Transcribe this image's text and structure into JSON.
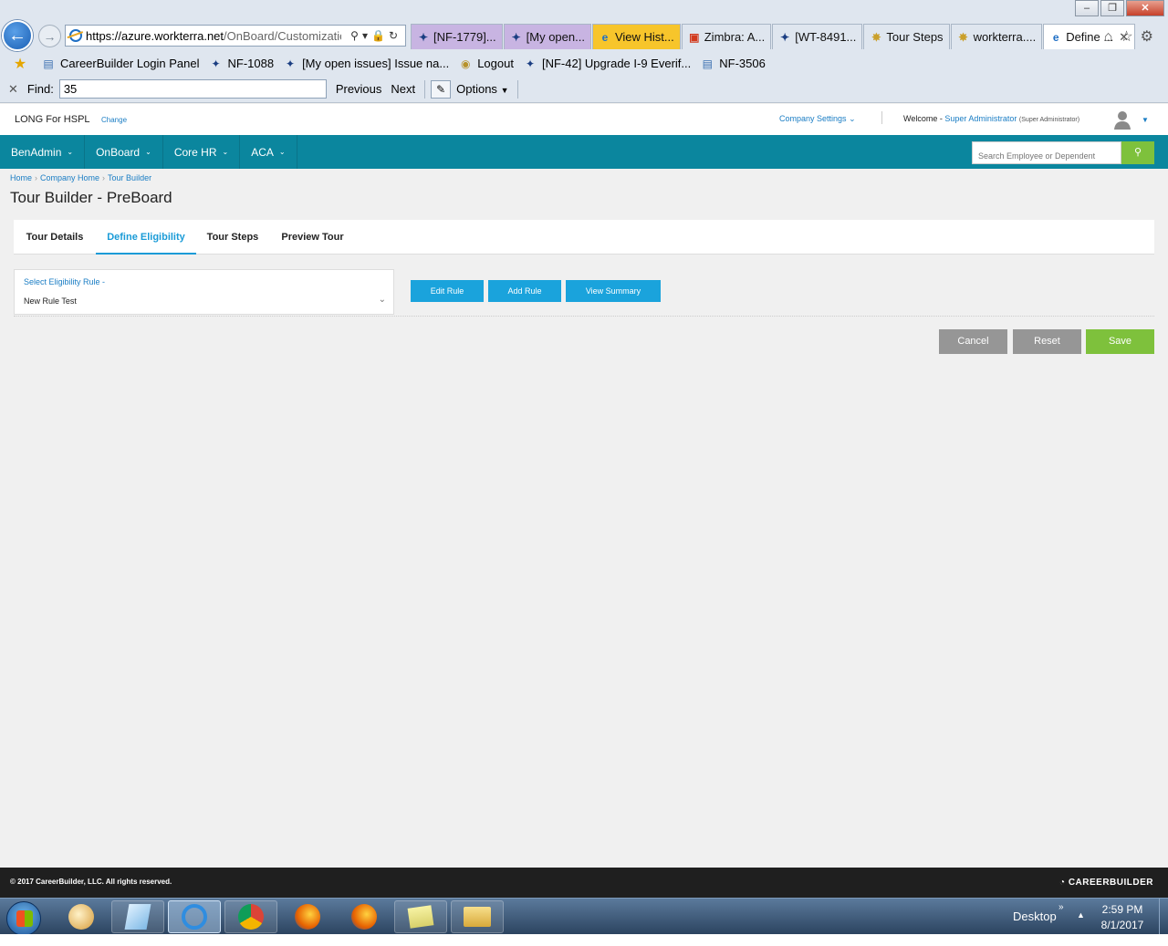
{
  "browser": {
    "url_host": "https://azure.workterra.net",
    "url_path": "/OnBoard/Customization/",
    "tabs": [
      {
        "label": "[NF-1779]...",
        "style": "purple",
        "icon": "jira-icon"
      },
      {
        "label": "[My open...",
        "style": "purple",
        "icon": "jira-icon"
      },
      {
        "label": "View Hist...",
        "style": "yellow",
        "icon": "ie-icon"
      },
      {
        "label": "Zimbra: A...",
        "style": "plain",
        "icon": "zimbra-icon"
      },
      {
        "label": "[WT-8491...",
        "style": "plain",
        "icon": "jira-icon"
      },
      {
        "label": "Tour Steps",
        "style": "plain",
        "icon": "workterra-icon"
      },
      {
        "label": "workterra....",
        "style": "plain",
        "icon": "workterra-icon"
      },
      {
        "label": "Define ...",
        "style": "active",
        "icon": "ie-icon"
      }
    ],
    "favorites": [
      {
        "label": "CareerBuilder Login Panel",
        "icon": "page-icon"
      },
      {
        "label": "NF-1088",
        "icon": "jira-icon"
      },
      {
        "label": "[My open issues] Issue na...",
        "icon": "jira-icon"
      },
      {
        "label": "Logout",
        "icon": "workterra-icon"
      },
      {
        "label": "[NF-42] Upgrade I-9 Everif...",
        "icon": "jira-icon"
      },
      {
        "label": "NF-3506",
        "icon": "page-icon"
      }
    ],
    "find": {
      "label": "Find:",
      "value": "35",
      "previous": "Previous",
      "next": "Next",
      "options": "Options"
    }
  },
  "header": {
    "company": "LONG For HSPL",
    "change": "Change",
    "company_settings": "Company Settings",
    "welcome_prefix": "Welcome -",
    "user_name": "Super Administrator",
    "user_role": "(Super Administrator)"
  },
  "nav": {
    "items": [
      "BenAdmin",
      "OnBoard",
      "Core HR",
      "ACA"
    ],
    "search_placeholder": "Search Employee or Dependent"
  },
  "breadcrumb": [
    "Home",
    "Company Home",
    "Tour Builder"
  ],
  "page": {
    "title": "Tour Builder - PreBoard",
    "tabs": [
      "Tour Details",
      "Define Eligibility",
      "Tour Steps",
      "Preview Tour"
    ],
    "active_tab": "Define Eligibility",
    "rule_label": "Select Eligibility Rule -",
    "rule_value": "New Rule Test",
    "buttons": {
      "edit": "Edit Rule",
      "add": "Add Rule",
      "summary": "View Summary"
    },
    "actions": {
      "cancel": "Cancel",
      "reset": "Reset",
      "save": "Save"
    }
  },
  "footer": {
    "copyright": "© 2017 CareerBuilder, LLC. All rights reserved.",
    "brand": "CAREERBUILDER"
  },
  "taskbar": {
    "desktop": "Desktop",
    "time": "2:59 PM",
    "date": "8/1/2017"
  },
  "colors": {
    "nav_bg": "#0b869e",
    "accent": "#1aa3dc",
    "save": "#7ec13c",
    "neutral_button": "#969696"
  }
}
